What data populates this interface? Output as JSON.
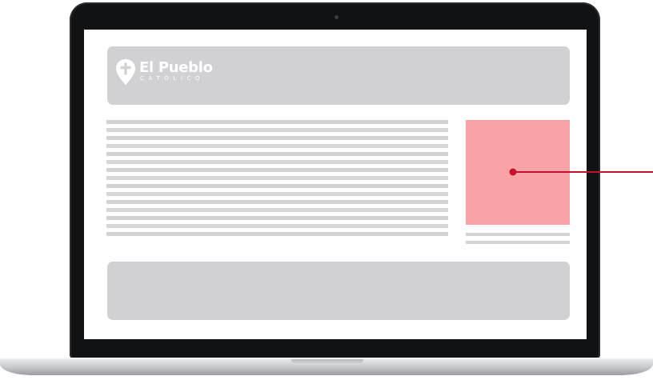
{
  "logo": {
    "title": "El Pueblo",
    "subtitle": "CATÓLICO",
    "icon": "map-pin-cross-icon"
  },
  "colors": {
    "bezel": "#111214",
    "placeholder_gray": "#d1d1d3",
    "image_placeholder": "#f8a3a6",
    "pointer": "#c8102e"
  },
  "content": {
    "text_line_count": 15,
    "caption_line_count": 2
  }
}
